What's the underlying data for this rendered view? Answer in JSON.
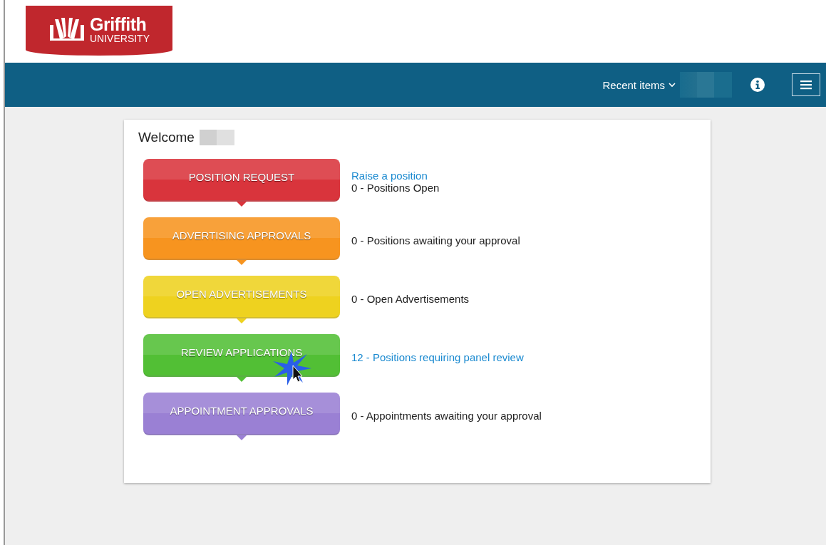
{
  "logo": {
    "name": "Griffith",
    "subtitle": "UNIVERSITY"
  },
  "navbar": {
    "recent_items": "Recent items"
  },
  "welcome": "Welcome",
  "tiles": [
    {
      "label": "POSITION REQUEST",
      "color": "#d9343c",
      "pointer": false,
      "lines": [
        {
          "kind": "link",
          "text": "Raise a position"
        },
        {
          "kind": "text",
          "text": "0 - Positions Open"
        }
      ]
    },
    {
      "label": "ADVERTISING APPROVALS",
      "color": "#f7941f",
      "pointer": false,
      "lines": [
        {
          "kind": "text",
          "text": "0 - Positions awaiting your approval"
        }
      ]
    },
    {
      "label": "OPEN ADVERTISEMENTS",
      "color": "#eed21f",
      "pointer": false,
      "lines": [
        {
          "kind": "text",
          "text": "0 - Open Advertisements"
        }
      ]
    },
    {
      "label": "REVIEW APPLICATIONS",
      "color": "#52bf35",
      "pointer": true,
      "lines": [
        {
          "kind": "link",
          "text": "12 - Positions requiring panel review"
        }
      ]
    },
    {
      "label": "APPOINTMENT APPROVALS",
      "color": "#9a80d4",
      "pointer": false,
      "lines": [
        {
          "kind": "text",
          "text": "0 - Appointments awaiting your approval"
        }
      ]
    }
  ]
}
